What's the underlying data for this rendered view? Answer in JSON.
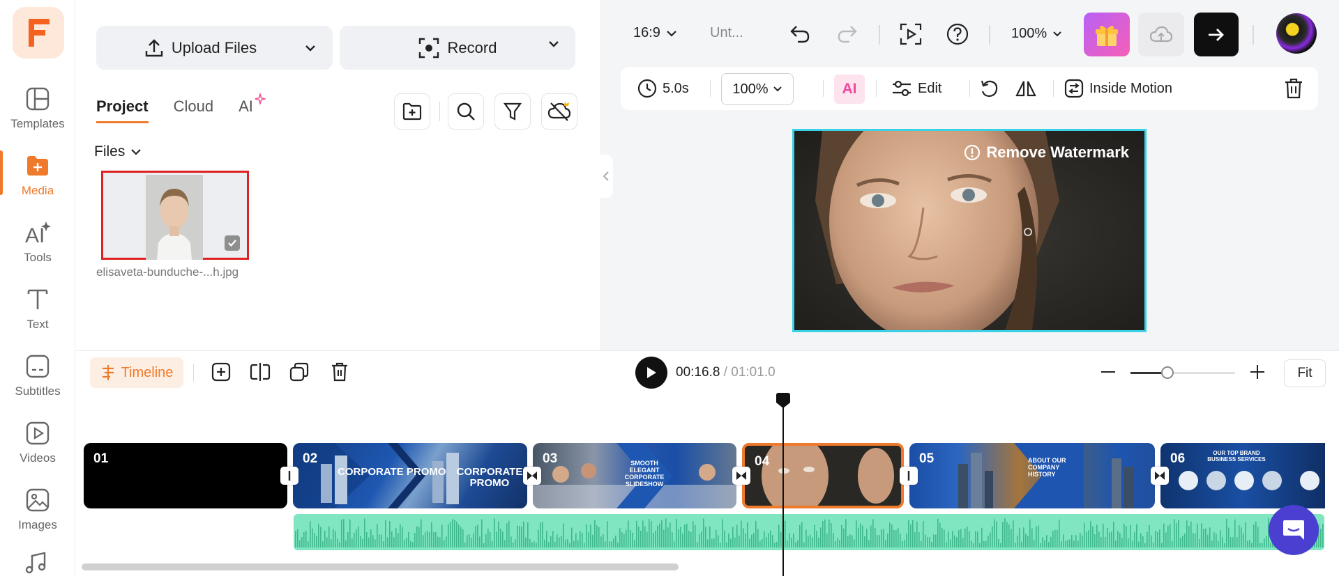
{
  "rail": {
    "items": [
      {
        "label": "Templates",
        "icon": "templates-icon"
      },
      {
        "label": "Media",
        "icon": "media-icon",
        "active": true
      },
      {
        "label": "Tools",
        "icon": "ai-tools-icon"
      },
      {
        "label": "Text",
        "icon": "text-icon"
      },
      {
        "label": "Subtitles",
        "icon": "subtitles-icon"
      },
      {
        "label": "Videos",
        "icon": "videos-icon"
      },
      {
        "label": "Images",
        "icon": "images-icon"
      }
    ]
  },
  "media": {
    "upload_label": "Upload Files",
    "record_label": "Record",
    "tabs": [
      {
        "label": "Project",
        "active": true
      },
      {
        "label": "Cloud"
      },
      {
        "label": "AI"
      }
    ],
    "files_label": "Files",
    "file_name": "elisaveta-bunduche-...h.jpg"
  },
  "preview": {
    "aspect_ratio": "16:9",
    "project_title": "Unt...",
    "zoom_level": "100%",
    "duration": "5.0s",
    "speed": "100%",
    "ai_label": "AI",
    "edit_label": "Edit",
    "motion_label": "Inside Motion",
    "watermark_label": "Remove Watermark"
  },
  "timeline": {
    "chip_label": "Timeline",
    "current_time": "00:16.8",
    "separator": " / ",
    "total_time": "01:01.0",
    "fit_label": "Fit",
    "zoom_fraction": 0.35,
    "clips": [
      {
        "label": "01"
      },
      {
        "label": "02",
        "text": "CORPORATE PROMO"
      },
      {
        "label": "03",
        "text": "SMOOTH ELEGANT CORPORATE SLIDESHOW"
      },
      {
        "label": "04"
      },
      {
        "label": "05",
        "text": "ABOUT OUR COMPANY HISTORY"
      },
      {
        "label": "06",
        "text": "OUR TOP BRAND BUSINESS SERVICES"
      }
    ]
  },
  "colors": {
    "accent": "#f07a2b",
    "selection": "#3ad1e6",
    "audio": "#7fe6c1"
  }
}
